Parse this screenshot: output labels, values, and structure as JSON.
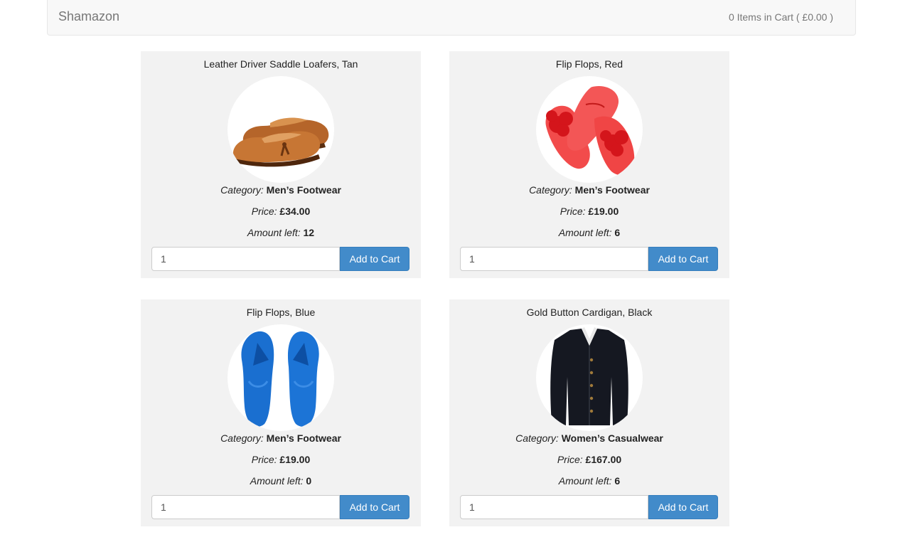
{
  "navbar": {
    "brand": "Shamazon",
    "cart_summary": "0 Items in Cart ( £0.00 )"
  },
  "labels": {
    "category": "Category:",
    "price": "Price:",
    "amount_left": "Amount left:",
    "add_to_cart": "Add to Cart"
  },
  "products": [
    {
      "title": "Leather Driver Saddle Loafers, Tan",
      "category": "Men’s Footwear",
      "price": "£34.00",
      "amount_left": "12",
      "quantity": "1",
      "image_icon": "loafer-shoes-image"
    },
    {
      "title": "Flip Flops, Red",
      "category": "Men’s Footwear",
      "price": "£19.00",
      "amount_left": "6",
      "quantity": "1",
      "image_icon": "red-flip-flops-image"
    },
    {
      "title": "Flip Flops, Blue",
      "category": "Men’s Footwear",
      "price": "£19.00",
      "amount_left": "0",
      "quantity": "1",
      "image_icon": "blue-flip-flops-image"
    },
    {
      "title": "Gold Button Cardigan, Black",
      "category": "Women’s Casualwear",
      "price": "£167.00",
      "amount_left": "6",
      "quantity": "1",
      "image_icon": "black-cardigan-image"
    }
  ],
  "colors": {
    "button": "#428bca",
    "card_bg": "#f2f2f2",
    "navbar_bg": "#f8f8f8"
  }
}
